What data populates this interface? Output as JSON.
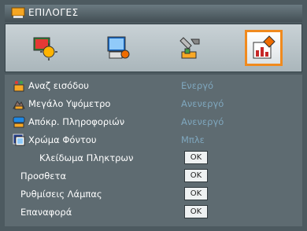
{
  "window": {
    "title": "ΕΠΙΛΟΓΕΣ"
  },
  "tabs": [
    {
      "icon": "image-settings-icon",
      "selected": false
    },
    {
      "icon": "display-settings-icon",
      "selected": false
    },
    {
      "icon": "setup-settings-icon",
      "selected": false
    },
    {
      "icon": "options-settings-icon",
      "selected": true
    }
  ],
  "menu": {
    "items": [
      {
        "label": "Αναζ εισόδου",
        "value": "Ενεργό",
        "icon": "source-lock-icon"
      },
      {
        "label": "Μεγάλο Υψόμετρο",
        "value": "Ανενεργό",
        "icon": "high-altitude-icon"
      },
      {
        "label": "Απόκρ. Πληροφοριών",
        "value": "Ανενεργό",
        "icon": "info-hide-icon"
      },
      {
        "label": "Χρώμα Φόντου",
        "value": "Μπλε",
        "icon": "background-color-icon"
      }
    ],
    "buttons": [
      {
        "label": "Κλείδωμα Πληκτρων",
        "button": "OK"
      },
      {
        "label": "Προσθετα",
        "button": "OK"
      },
      {
        "label": "Ρυθμίσεις Λάμπας",
        "button": "OK"
      },
      {
        "label": "Επαναφορά",
        "button": "OK"
      }
    ]
  },
  "colors": {
    "accent": "#f08a1e",
    "value_text": "#7fa7be",
    "panel": "#5e6b71"
  }
}
